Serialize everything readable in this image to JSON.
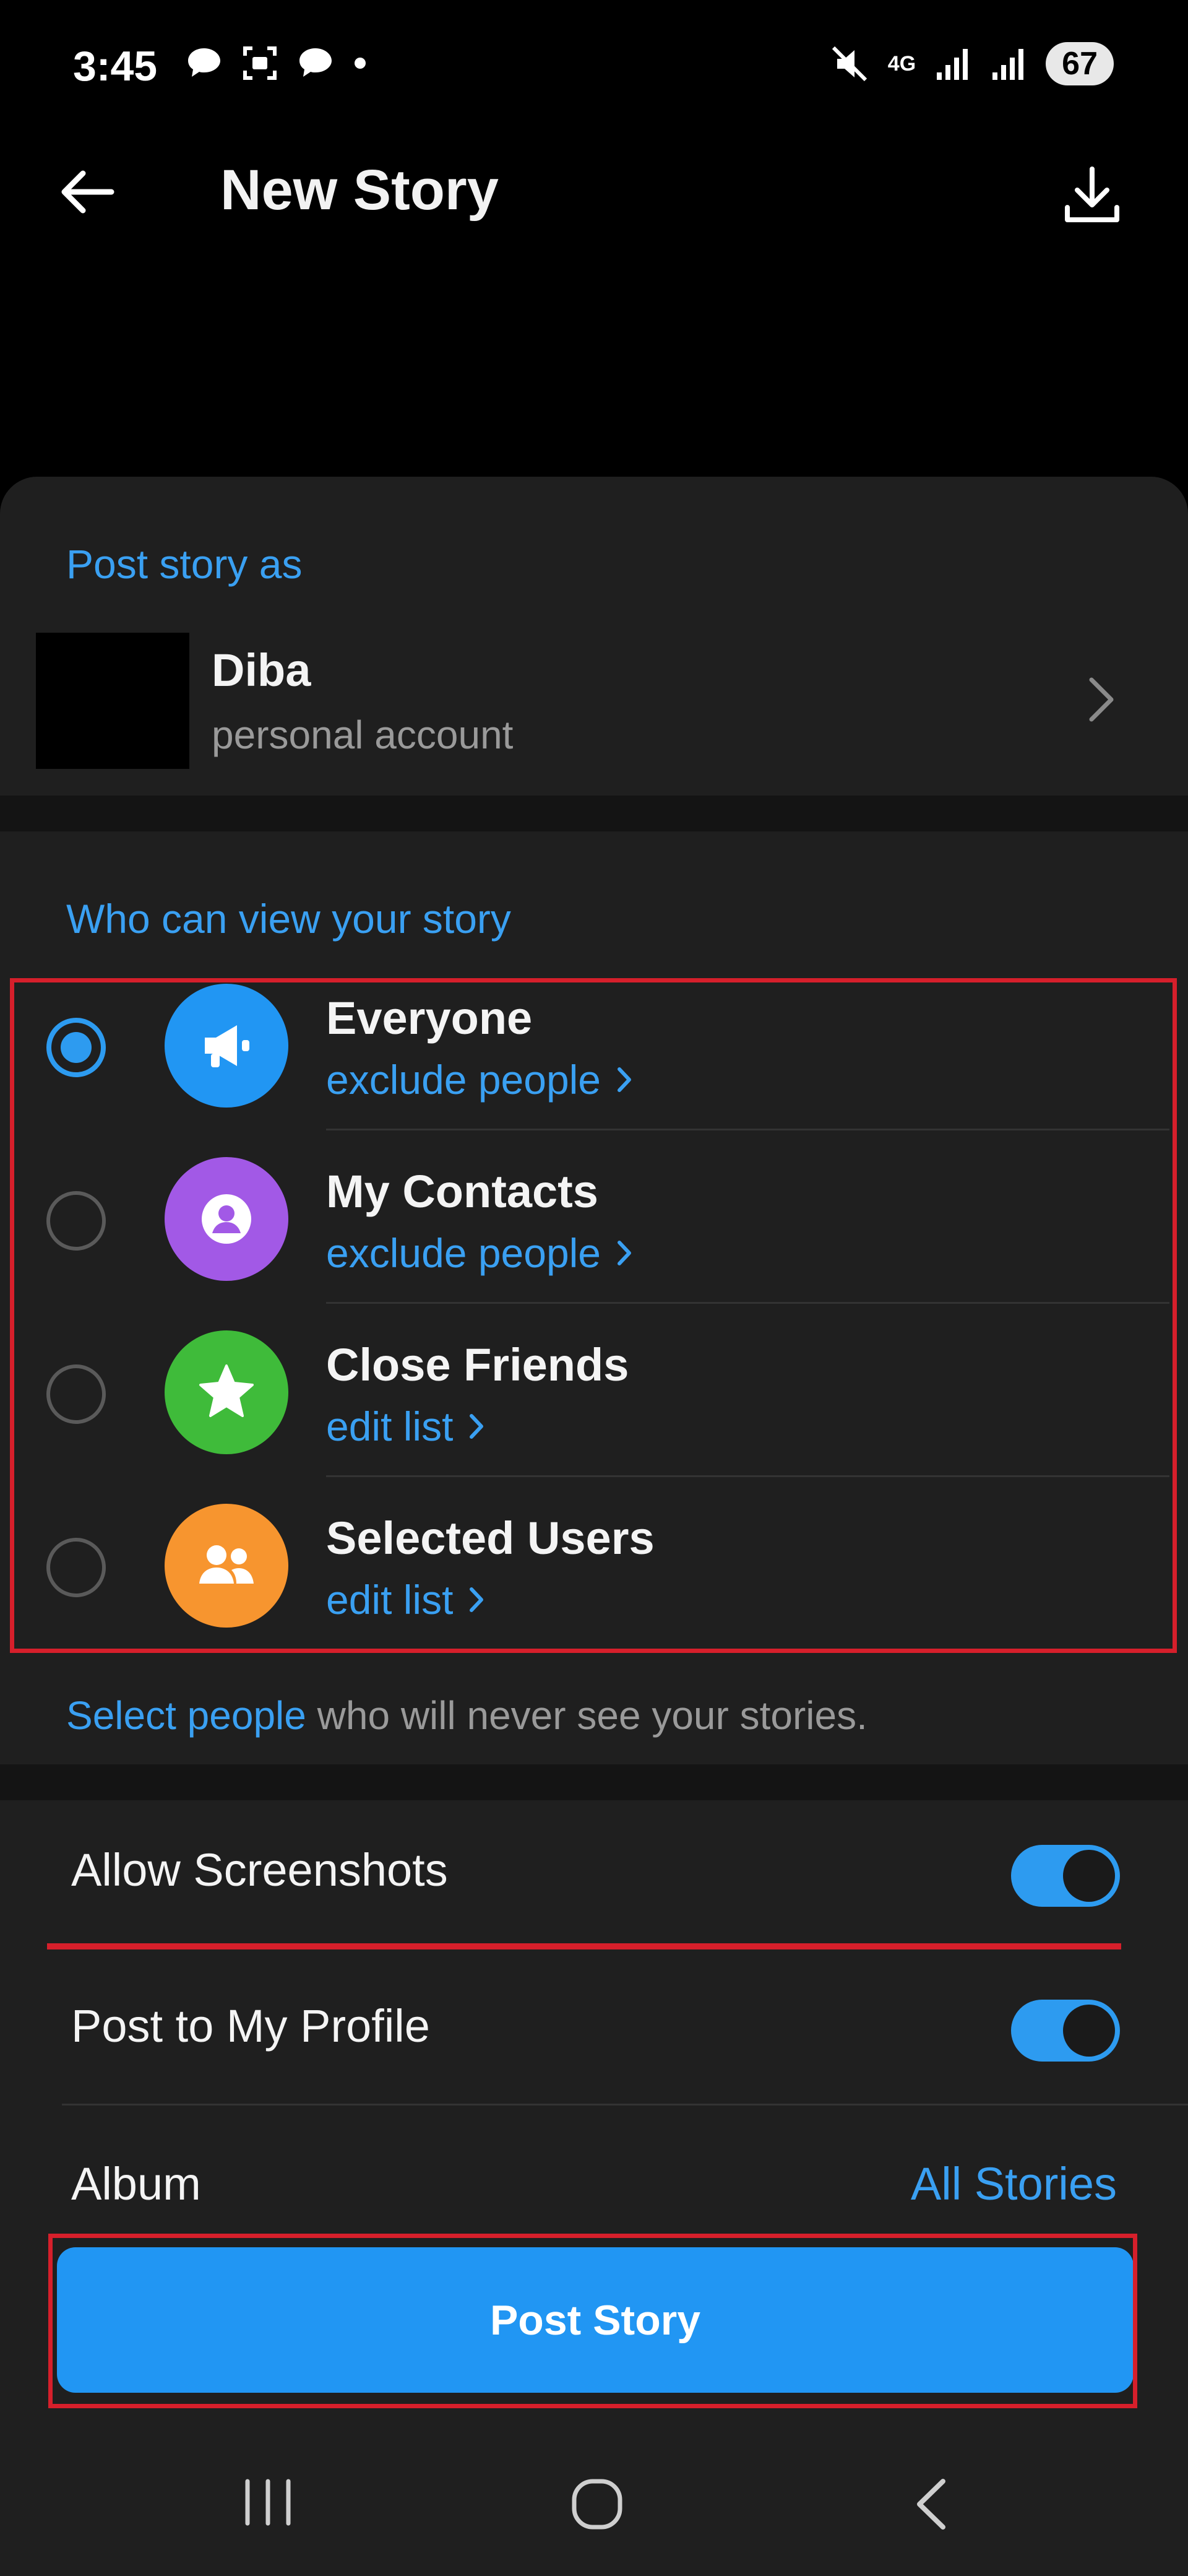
{
  "status_bar": {
    "time": "3:45",
    "battery": "67",
    "network": "4G"
  },
  "header": {
    "title": "New Story"
  },
  "post_as": {
    "section_label": "Post story as",
    "account_name": "Diba",
    "account_type": "personal account"
  },
  "visibility": {
    "section_label": "Who can view your story",
    "selected": "Everyone",
    "options": [
      {
        "title": "Everyone",
        "action": "exclude people",
        "icon": "megaphone-icon",
        "color": "#2196f3"
      },
      {
        "title": "My Contacts",
        "action": "exclude people",
        "icon": "contact-icon",
        "color": "#a259e6"
      },
      {
        "title": "Close Friends",
        "action": "edit list",
        "icon": "star-icon",
        "color": "#3fbb3a"
      },
      {
        "title": "Selected Users",
        "action": "edit list",
        "icon": "group-icon",
        "color": "#f7952f"
      }
    ],
    "hint_link": "Select people",
    "hint_rest": " who will never see your stories."
  },
  "settings": {
    "allow_screenshots_label": "Allow Screenshots",
    "allow_screenshots_on": true,
    "post_to_profile_label": "Post to My Profile",
    "post_to_profile_on": true,
    "album_label": "Album",
    "album_value": "All Stories"
  },
  "footer": {
    "post_button_label": "Post Story"
  },
  "colors": {
    "accent": "#3aa0f2",
    "annotation_red": "#d61f2b"
  }
}
